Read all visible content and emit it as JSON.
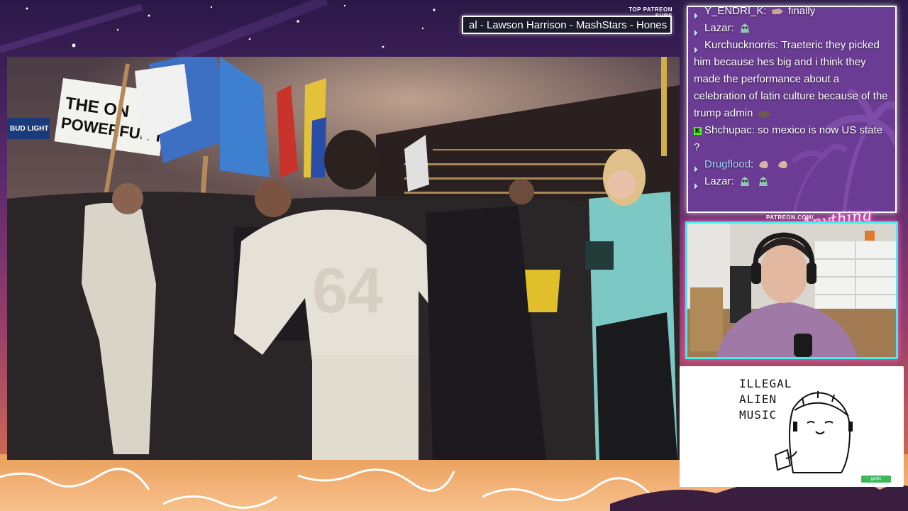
{
  "ticker": {
    "label": "TOP PATREON SUBS",
    "text": "al - Lawson Harrison - MashStars - Hones"
  },
  "chat": {
    "messages": [
      {
        "badge": "twitch",
        "user": "Y_ENDRI_K",
        "sep": ":",
        "text": " finally",
        "emotes": [
          "emote-pointing"
        ]
      },
      {
        "badge": "twitch",
        "user": "Lazar",
        "sep": ":",
        "text": "",
        "emotes": [
          "emote-alien-rock"
        ]
      },
      {
        "badge": "twitch",
        "user": "Kurchucknorris",
        "sep": ":",
        "text": " Traeteric they picked him because hes big and i think they made the performance about a celebration of latin culture because of the trump admin",
        "emotes": [
          "emote-rock"
        ]
      },
      {
        "badge": "kick",
        "user": "Shchupac",
        "sep": ":",
        "text": " so mexico is now US state ?",
        "emotes": []
      },
      {
        "badge": "twitch",
        "user": "Drugflood",
        "sep": ":",
        "text": "",
        "emotes": [
          "emote-hand",
          "emote-hand"
        ],
        "user_color": "#9fd0ff"
      },
      {
        "badge": "twitch",
        "user": "Lazar",
        "sep": ":",
        "text": "",
        "emotes": [
          "emote-alien-rock",
          "emote-alien-rock"
        ]
      }
    ]
  },
  "webcam": {
    "header": "PATREON.COM/",
    "logo": "Anything Else"
  },
  "drawing": {
    "lines": [
      "ILLEGAL",
      "ALIEN",
      "MUSIC"
    ],
    "tag": "gartic"
  },
  "video": {
    "sign_text_1": "THE ON",
    "sign_text_2": "POWERFUL T",
    "jersey_number": "64",
    "banner": "BUD LIGHT"
  },
  "colors": {
    "webcam_border": "#3ff0e8",
    "chat_bg": "#6a3c93",
    "accent_pink": "#ff5ccf"
  }
}
